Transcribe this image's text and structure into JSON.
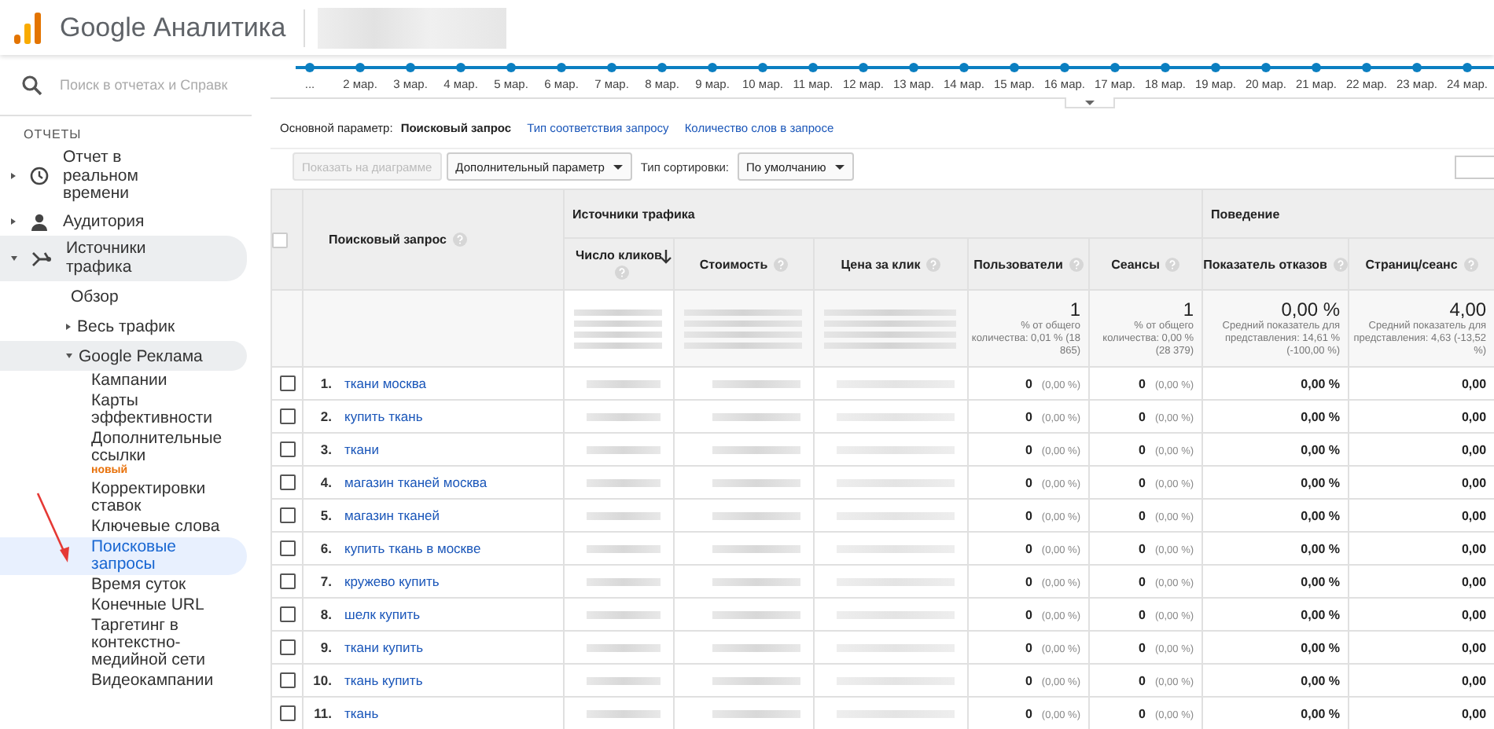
{
  "header": {
    "product": "Google Аналитика"
  },
  "sidebar": {
    "search": {
      "placeholder": "Поиск в отчетах и Справк"
    },
    "section": "ОТЧЕТЫ",
    "items": [
      {
        "label": "Отчет в реальном времени",
        "expanded": false
      },
      {
        "label": "Аудитория",
        "expanded": false
      },
      {
        "label": "Источники трафика",
        "expanded": true,
        "children": [
          {
            "label": "Обзор"
          },
          {
            "label": "Весь трафик",
            "expanded": false
          },
          {
            "label": "Google Реклама",
            "expanded": true,
            "children": [
              {
                "label": "Кампании",
                "selected": false
              },
              {
                "label": "Карты эффективности",
                "selected": false
              },
              {
                "label": "Дополнительные ссылки",
                "badge": "новый",
                "selected": false
              },
              {
                "label": "Корректировки ставок",
                "selected": false
              },
              {
                "label": "Ключевые слова",
                "selected": false
              },
              {
                "label": "Поисковые запросы",
                "selected": true
              },
              {
                "label": "Время суток",
                "selected": false
              },
              {
                "label": "Конечные URL",
                "selected": false
              },
              {
                "label": "Таргетинг в контекстно-медийной сети",
                "selected": false
              },
              {
                "label": "Видеокампании",
                "selected": false
              }
            ]
          }
        ]
      }
    ]
  },
  "timeline": {
    "labels": [
      "...",
      "2 мар.",
      "3 мар.",
      "4 мар.",
      "5 мар.",
      "6 мар.",
      "7 мар.",
      "8 мар.",
      "9 мар.",
      "10 мар.",
      "11 мар.",
      "12 мар.",
      "13 мар.",
      "14 мар.",
      "15 мар.",
      "16 мар.",
      "17 мар.",
      "18 мар.",
      "19 мар.",
      "20 мар.",
      "21 мар.",
      "22 мар.",
      "23 мар.",
      "24 мар."
    ]
  },
  "primary_dimension": {
    "label": "Основной параметр:",
    "options": [
      {
        "label": "Поисковый запрос",
        "selected": true
      },
      {
        "label": "Тип соответствия запросу",
        "selected": false
      },
      {
        "label": "Количество слов в запросе",
        "selected": false
      }
    ]
  },
  "toolbar": {
    "chart_button": {
      "label": "Показать на диаграмме",
      "disabled": true
    },
    "secondary_dropdown": "Дополнительный параметр",
    "sort_label": "Тип сортировки:",
    "sort_dropdown": "По умолчанию"
  },
  "table": {
    "select_all_checked": false,
    "groups": [
      "Источники трафика",
      "Поведение"
    ],
    "columns": [
      {
        "label": "Поисковый запрос",
        "sorted": false
      },
      {
        "label": "Число кликов",
        "sorted": true
      },
      {
        "label": "Стоимость",
        "sorted": false
      },
      {
        "label": "Цена за клик",
        "sorted": false
      },
      {
        "label": "Пользователи",
        "sorted": false
      },
      {
        "label": "Сеансы",
        "sorted": false
      },
      {
        "label": "Показатель отказов",
        "sorted": false
      },
      {
        "label": "Страниц/сеанс",
        "sorted": false
      }
    ],
    "totals": [
      {
        "value": "1",
        "note": "% от общего количества: 0,01 % (18 865)"
      },
      {
        "value": "1",
        "note": "% от общего количества: 0,00 % (28 379)"
      },
      {
        "value": "0,00 %",
        "note": "Средний показатель для представления: 14,61 % (-100,00 %)"
      },
      {
        "value": "4,00",
        "note": "Средний показатель для представления: 4,63 (-13,52 %)"
      }
    ],
    "rows": [
      {
        "checked": false,
        "index": "1.",
        "query": "ткани москва",
        "users": "0",
        "users_pct": "(0,00 %)",
        "sessions": "0",
        "sessions_pct": "(0,00 %)",
        "bounce": "0,00 %",
        "pages": "0,00"
      },
      {
        "checked": false,
        "index": "2.",
        "query": "купить ткань",
        "users": "0",
        "users_pct": "(0,00 %)",
        "sessions": "0",
        "sessions_pct": "(0,00 %)",
        "bounce": "0,00 %",
        "pages": "0,00"
      },
      {
        "checked": false,
        "index": "3.",
        "query": "ткани",
        "users": "0",
        "users_pct": "(0,00 %)",
        "sessions": "0",
        "sessions_pct": "(0,00 %)",
        "bounce": "0,00 %",
        "pages": "0,00"
      },
      {
        "checked": false,
        "index": "4.",
        "query": "магазин тканей москва",
        "users": "0",
        "users_pct": "(0,00 %)",
        "sessions": "0",
        "sessions_pct": "(0,00 %)",
        "bounce": "0,00 %",
        "pages": "0,00"
      },
      {
        "checked": false,
        "index": "5.",
        "query": "магазин тканей",
        "users": "0",
        "users_pct": "(0,00 %)",
        "sessions": "0",
        "sessions_pct": "(0,00 %)",
        "bounce": "0,00 %",
        "pages": "0,00"
      },
      {
        "checked": false,
        "index": "6.",
        "query": "купить ткань в москве",
        "users": "0",
        "users_pct": "(0,00 %)",
        "sessions": "0",
        "sessions_pct": "(0,00 %)",
        "bounce": "0,00 %",
        "pages": "0,00"
      },
      {
        "checked": false,
        "index": "7.",
        "query": "кружево купить",
        "users": "0",
        "users_pct": "(0,00 %)",
        "sessions": "0",
        "sessions_pct": "(0,00 %)",
        "bounce": "0,00 %",
        "pages": "0,00"
      },
      {
        "checked": false,
        "index": "8.",
        "query": "шелк купить",
        "users": "0",
        "users_pct": "(0,00 %)",
        "sessions": "0",
        "sessions_pct": "(0,00 %)",
        "bounce": "0,00 %",
        "pages": "0,00"
      },
      {
        "checked": false,
        "index": "9.",
        "query": "ткани купить",
        "users": "0",
        "users_pct": "(0,00 %)",
        "sessions": "0",
        "sessions_pct": "(0,00 %)",
        "bounce": "0,00 %",
        "pages": "0,00"
      },
      {
        "checked": false,
        "index": "10.",
        "query": "ткань купить",
        "users": "0",
        "users_pct": "(0,00 %)",
        "sessions": "0",
        "sessions_pct": "(0,00 %)",
        "bounce": "0,00 %",
        "pages": "0,00"
      },
      {
        "checked": false,
        "index": "11.",
        "query": "ткань",
        "users": "0",
        "users_pct": "(0,00 %)",
        "sessions": "0",
        "sessions_pct": "(0,00 %)",
        "bounce": "0,00 %",
        "pages": "0,00"
      }
    ]
  }
}
